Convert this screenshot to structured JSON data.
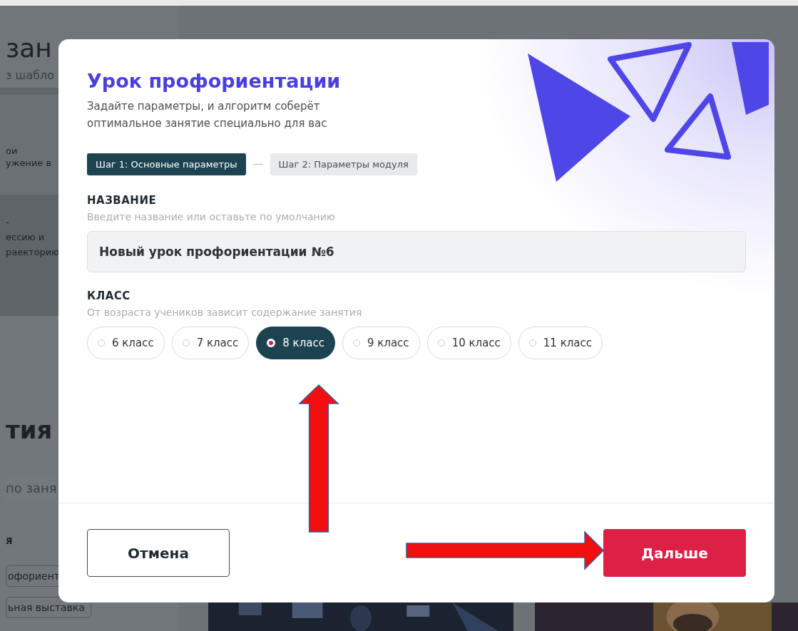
{
  "background": {
    "heading": "зан",
    "subheading": "з шабло",
    "card_1_lines": [
      "ои",
      "ужение в"
    ],
    "card_2_lines": [
      "-",
      "ессию и",
      "раекторию"
    ],
    "section_title": "тия",
    "search": {
      "placeholder": "по заня"
    },
    "filter_label": "я",
    "filter_chips": [
      "офориент",
      "ьная выставка"
    ],
    "pictures": [
      {
        "kind": "picture"
      },
      {
        "kind": "picture"
      }
    ]
  },
  "dialog": {
    "title": "Урок профориентации",
    "subtitle": "Задайте параметры, и алгоритм соберёт оптимальное занятие специально для вас",
    "steps": [
      {
        "label": "Шаг 1: Основные параметры",
        "selected": true
      },
      {
        "label": "Шаг 2: Параметры модуля",
        "selected": false
      }
    ],
    "name_field": {
      "label": "НАЗВАНИЕ",
      "hint": "Введите название или оставьте по умолчанию",
      "value": "Новый урок профориентации №6"
    },
    "grade": {
      "label": "КЛАСС",
      "hint": "От возраста учеников зависит содержание занятия",
      "options": [
        {
          "label": "6 класс",
          "selected": false
        },
        {
          "label": "7 класс",
          "selected": false
        },
        {
          "label": "8 класс",
          "selected": true
        },
        {
          "label": "9 класс",
          "selected": false
        },
        {
          "label": "10 класс",
          "selected": false
        },
        {
          "label": "11 класс",
          "selected": false
        }
      ]
    },
    "buttons": [
      {
        "label": "Отмена",
        "kind": "secondary"
      },
      {
        "label": "Дальше",
        "kind": "primary"
      }
    ]
  },
  "annotations": [
    {
      "kind": "arrow-up"
    },
    {
      "kind": "arrow-right"
    }
  ]
}
